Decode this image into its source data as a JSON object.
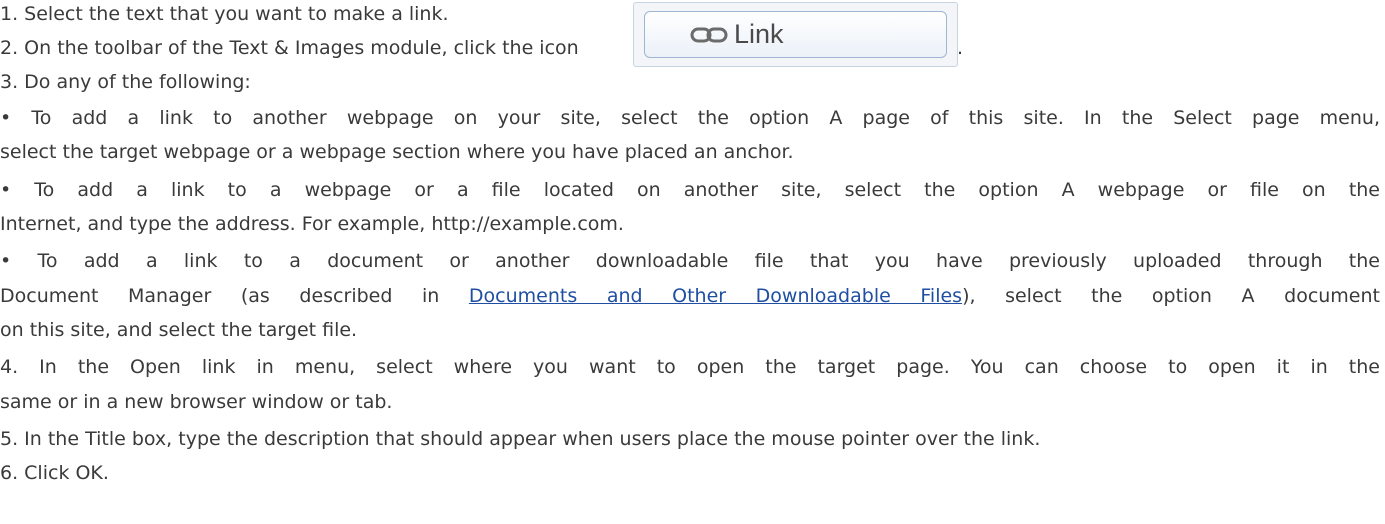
{
  "steps": {
    "s1": "1. Select the text that you want to make a link.",
    "s2": "2. On the toolbar of the Text & Images module, click the icon",
    "s2_period": ".",
    "s3": "3. Do any of the following:",
    "b1_l1": "• To add a link to another webpage on your site, select the option A page of this site. In the Select page menu,",
    "b1_l2": "select the target webpage or a webpage section where you have placed an anchor.",
    "b2_l1": "• To add a link to a webpage or a file located on another site, select the option A webpage or file on the",
    "b2_l2": "Internet, and type the address. For example, http://example.com.",
    "b3_l1": "• To add a link to a document or another downloadable file that you have previously uploaded through the",
    "b3_l2_pre": "Document Manager (as described in ",
    "b3_l2_link": "Documents and Other Downloadable Files",
    "b3_l2_post": "), select the option A document",
    "b3_l3": "on this site, and select the target file.",
    "s4_l1": "4. In the Open link in menu, select where you want to open the target page. You can choose to open it in the",
    "s4_l2": "same or in a new browser window or tab.",
    "s5": "5. In the Title box, type the description that should appear when users place the mouse pointer over the link.",
    "s6": "6. Click OK."
  },
  "link_button": {
    "label": "Link",
    "icon": "chain-link-icon"
  },
  "colors": {
    "text": "#3a3a3a",
    "link": "#1f4ea3"
  }
}
